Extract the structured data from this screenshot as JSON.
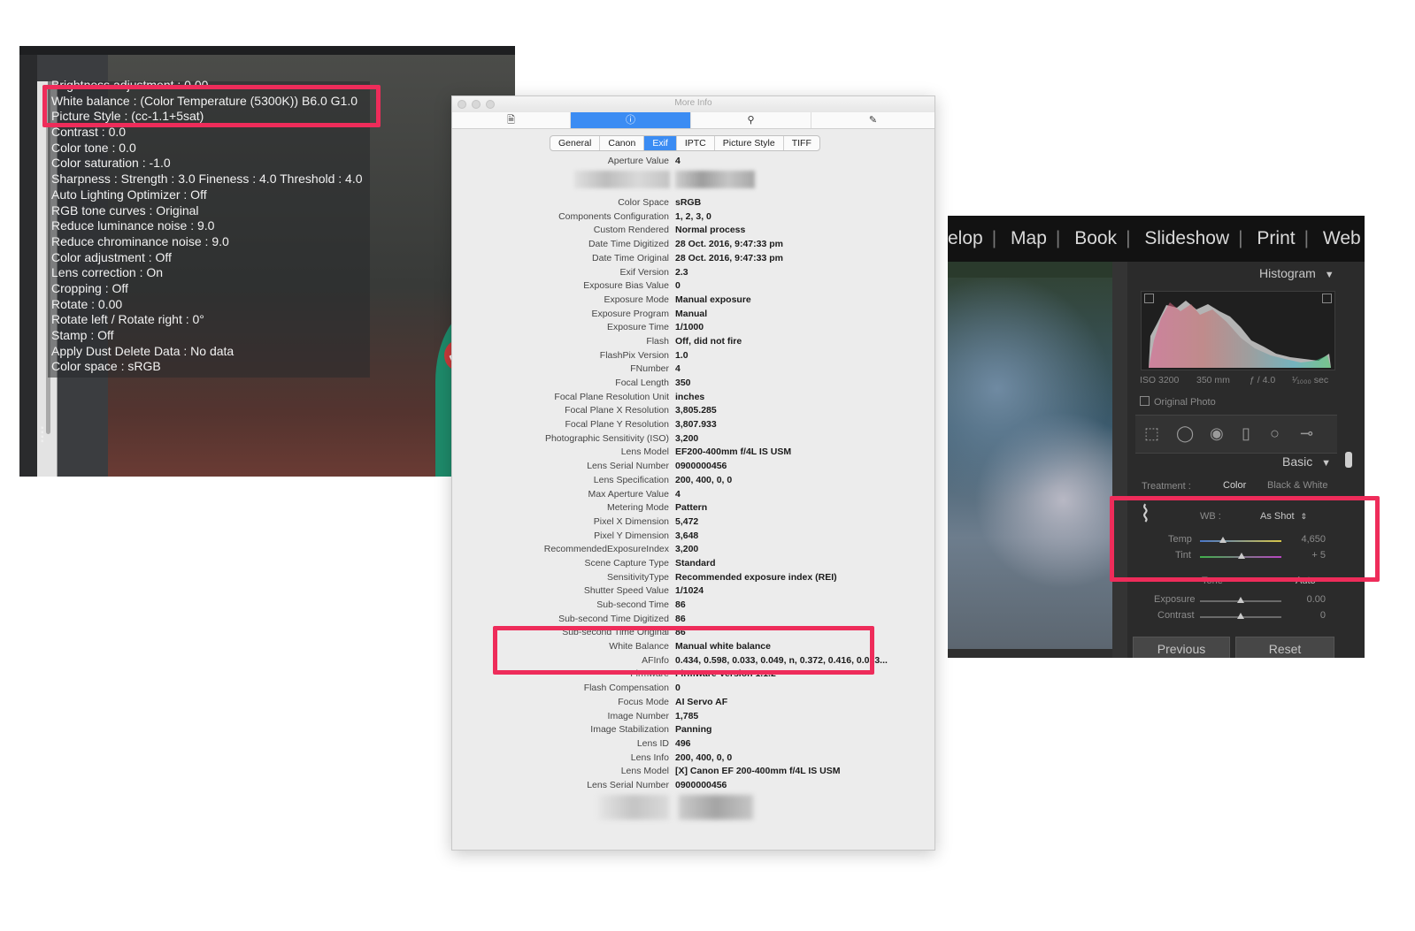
{
  "left_panel": {
    "lines": [
      "Brightness adjustment : 0.00",
      "White balance : (Color Temperature (5300K)) B6.0 G1.0",
      "Picture Style : (cc-1.1+5sat)",
      "Contrast : 0.0",
      "Color tone : 0.0",
      "Color saturation : -1.0",
      "Sharpness : Strength : 3.0 Fineness : 4.0 Threshold : 4.0",
      "Auto Lighting Optimizer : Off",
      "RGB tone curves : Original",
      "Reduce luminance noise : 9.0",
      "Reduce chrominance noise : 9.0",
      "Color adjustment  : Off",
      "Lens correction : On",
      "Cropping : Off",
      "Rotate : 0.00",
      "Rotate left / Rotate right : 0°",
      "Stamp : Off",
      "Apply Dust Delete Data : No data",
      "Color space : sRGB"
    ],
    "badge_text": "DON",
    "highlight_color": "#ee2c5a"
  },
  "info_window": {
    "title": "More Info",
    "toolbar_icons": [
      "document-icon",
      "info-icon",
      "search-icon",
      "pencil-icon"
    ],
    "toolbar_glyphs": [
      "🗎",
      "ⓘ",
      "⚲",
      "✎"
    ],
    "tabs": [
      "General",
      "Canon",
      "Exif",
      "IPTC",
      "Picture Style",
      "TIFF"
    ],
    "active_tab": "Exif",
    "rows": [
      {
        "k": "Aperture Value",
        "v": "4"
      },
      {
        "k": "",
        "v": ""
      },
      {
        "k": "",
        "v": ""
      },
      {
        "k": "Color Space",
        "v": "sRGB"
      },
      {
        "k": "Components Configuration",
        "v": "1, 2, 3, 0"
      },
      {
        "k": "Custom Rendered",
        "v": "Normal process"
      },
      {
        "k": "Date Time Digitized",
        "v": "28 Oct. 2016, 9:47:33 pm"
      },
      {
        "k": "Date Time Original",
        "v": "28 Oct. 2016, 9:47:33 pm"
      },
      {
        "k": "Exif Version",
        "v": "2.3"
      },
      {
        "k": "Exposure Bias Value",
        "v": "0"
      },
      {
        "k": "Exposure Mode",
        "v": "Manual exposure"
      },
      {
        "k": "Exposure Program",
        "v": "Manual"
      },
      {
        "k": "Exposure Time",
        "v": "1/1000"
      },
      {
        "k": "Flash",
        "v": "Off, did not fire"
      },
      {
        "k": "FlashPix Version",
        "v": "1.0"
      },
      {
        "k": "FNumber",
        "v": "4"
      },
      {
        "k": "Focal Length",
        "v": "350"
      },
      {
        "k": "Focal Plane Resolution Unit",
        "v": "inches"
      },
      {
        "k": "Focal Plane X Resolution",
        "v": "3,805.285"
      },
      {
        "k": "Focal Plane Y Resolution",
        "v": "3,807.933"
      },
      {
        "k": "Photographic Sensitivity (ISO)",
        "v": "3,200"
      },
      {
        "k": "Lens Model",
        "v": "EF200-400mm f/4L IS USM"
      },
      {
        "k": "Lens Serial Number",
        "v": "0900000456"
      },
      {
        "k": "Lens Specification",
        "v": "200, 400, 0, 0"
      },
      {
        "k": "Max Aperture Value",
        "v": "4"
      },
      {
        "k": "Metering Mode",
        "v": "Pattern"
      },
      {
        "k": "Pixel X Dimension",
        "v": "5,472"
      },
      {
        "k": "Pixel Y Dimension",
        "v": "3,648"
      },
      {
        "k": "RecommendedExposureIndex",
        "v": "3,200"
      },
      {
        "k": "Scene Capture Type",
        "v": "Standard"
      },
      {
        "k": "SensitivityType",
        "v": "Recommended exposure index (REI)"
      },
      {
        "k": "Shutter Speed Value",
        "v": "1/1024"
      },
      {
        "k": "Sub-second Time",
        "v": "86"
      },
      {
        "k": "Sub-second Time Digitized",
        "v": "86"
      },
      {
        "k": "Sub-second Time Original",
        "v": "86"
      },
      {
        "k": "White Balance",
        "v": "Manual white balance"
      },
      {
        "k": "AFInfo",
        "v": "0.434, 0.598, 0.033, 0.049, n, 0.372, 0.416, 0.033..."
      },
      {
        "k": "Firmware",
        "v": "Firmware Version 1.1.2"
      },
      {
        "k": "Flash Compensation",
        "v": "0"
      },
      {
        "k": "Focus Mode",
        "v": "AI Servo AF"
      },
      {
        "k": "Image Number",
        "v": "1,785"
      },
      {
        "k": "Image Stabilization",
        "v": "Panning"
      },
      {
        "k": "Lens ID",
        "v": "496"
      },
      {
        "k": "Lens Info",
        "v": "200, 400, 0, 0"
      },
      {
        "k": "Lens Model",
        "v": "[X] Canon EF 200-400mm f/4L IS USM"
      },
      {
        "k": "Lens Serial Number",
        "v": "0900000456"
      }
    ]
  },
  "lightroom": {
    "modules": [
      "elop",
      "Map",
      "Book",
      "Slideshow",
      "Print",
      "Web"
    ],
    "histogram": {
      "title": "Histogram",
      "iso": "ISO 3200",
      "focal": "350 mm",
      "aperture": "ƒ / 4.0",
      "shutter": "¹⁄₁₀₀₀ sec",
      "original_photo_label": "Original Photo"
    },
    "basic": {
      "title": "Basic",
      "treatment_label": "Treatment :",
      "treatment_color": "Color",
      "treatment_bw": "Black & White",
      "wb_label": "WB :",
      "wb_value": "As Shot",
      "temp_label": "Temp",
      "temp_value": "4,650",
      "tint_label": "Tint",
      "tint_value": "+ 5",
      "tone_label": "Tone",
      "tone_auto": "Auto",
      "exposure_label": "Exposure",
      "exposure_value": "0.00",
      "contrast_label": "Contrast",
      "contrast_value": "0"
    },
    "buttons": {
      "previous": "Previous",
      "reset": "Reset"
    },
    "dropdown_arrow": "▼",
    "stepper_glyph": "⇕"
  }
}
